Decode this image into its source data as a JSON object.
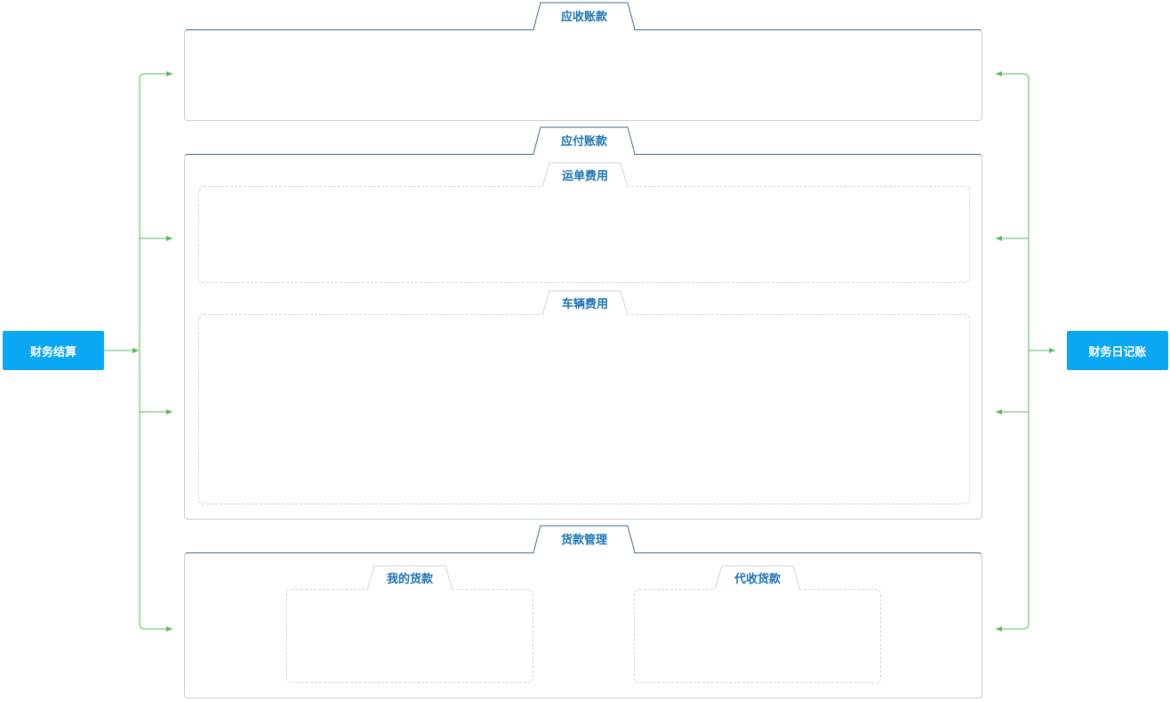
{
  "nodes": {
    "left": "财务结算",
    "right": "财务日记账"
  },
  "sections": {
    "receivable": {
      "title": "应收账款"
    },
    "payable": {
      "title": "应付账款",
      "waybill": "运单费用",
      "vehicle": "车辆费用"
    },
    "goods_payment": {
      "title": "货款管理",
      "mine": "我的货款",
      "collect": "代收货款"
    }
  },
  "colors": {
    "button": "#0aa7f5",
    "connector": "#5cb85c",
    "title_text": "#1b73b5",
    "section_top_border": "#3b6d97"
  }
}
